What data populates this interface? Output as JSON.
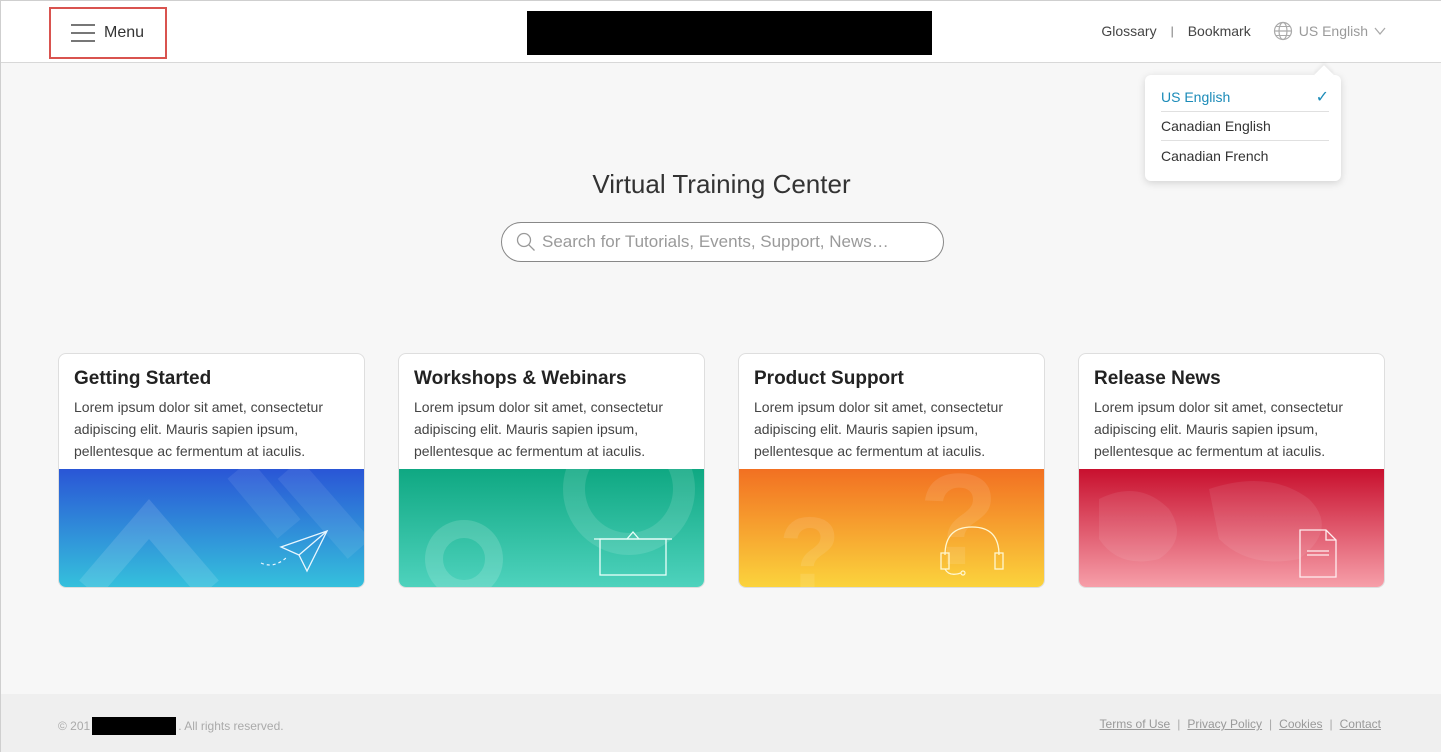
{
  "header": {
    "menu_label": "Menu",
    "links": {
      "glossary": "Glossary",
      "separator": "|",
      "bookmark": "Bookmark"
    },
    "language": {
      "selected": "US English"
    }
  },
  "language_dropdown": {
    "options": [
      {
        "label": "US English",
        "selected": true
      },
      {
        "label": "Canadian English",
        "selected": false
      },
      {
        "label": "Canadian French",
        "selected": false
      }
    ],
    "check_mark": "✓"
  },
  "hero": {
    "title": "Virtual Training Center",
    "search_placeholder": "Search for Tutorials, Events, Support, News…"
  },
  "cards": [
    {
      "title": "Getting Started",
      "description": "Lorem ipsum dolor sit amet, consectetur adipiscing elit. Mauris sapien ipsum, pellentesque ac fermentum at iaculis.",
      "icon": "paper-plane-icon",
      "gradient": [
        "#2a56d6",
        "#35c2dc"
      ]
    },
    {
      "title": "Workshops & Webinars",
      "description": "Lorem ipsum dolor sit amet, consectetur adipiscing elit. Mauris sapien ipsum, pellentesque ac fermentum at iaculis.",
      "icon": "presentation-board-icon",
      "gradient": [
        "#0fa882",
        "#4fd3be"
      ]
    },
    {
      "title": "Product Support",
      "description": "Lorem ipsum dolor sit amet, consectetur adipiscing elit. Mauris sapien ipsum, pellentesque ac fermentum at iaculis.",
      "icon": "headset-icon",
      "gradient": [
        "#f27022",
        "#fbd53d"
      ]
    },
    {
      "title": "Release News",
      "description": "Lorem ipsum dolor sit amet, consectetur adipiscing elit. Mauris sapien ipsum, pellentesque ac fermentum at iaculis.",
      "icon": "document-icon",
      "gradient": [
        "#c8102e",
        "#f7a1ab"
      ]
    }
  ],
  "footer": {
    "copyright_prefix": "© 201",
    "copyright_suffix": ". All rights reserved.",
    "links": [
      "Terms of Use",
      "Privacy Policy",
      "Cookies",
      "Contact"
    ]
  },
  "colors": {
    "accent": "#1b8bb8",
    "menu_highlight": "#d9534f"
  }
}
